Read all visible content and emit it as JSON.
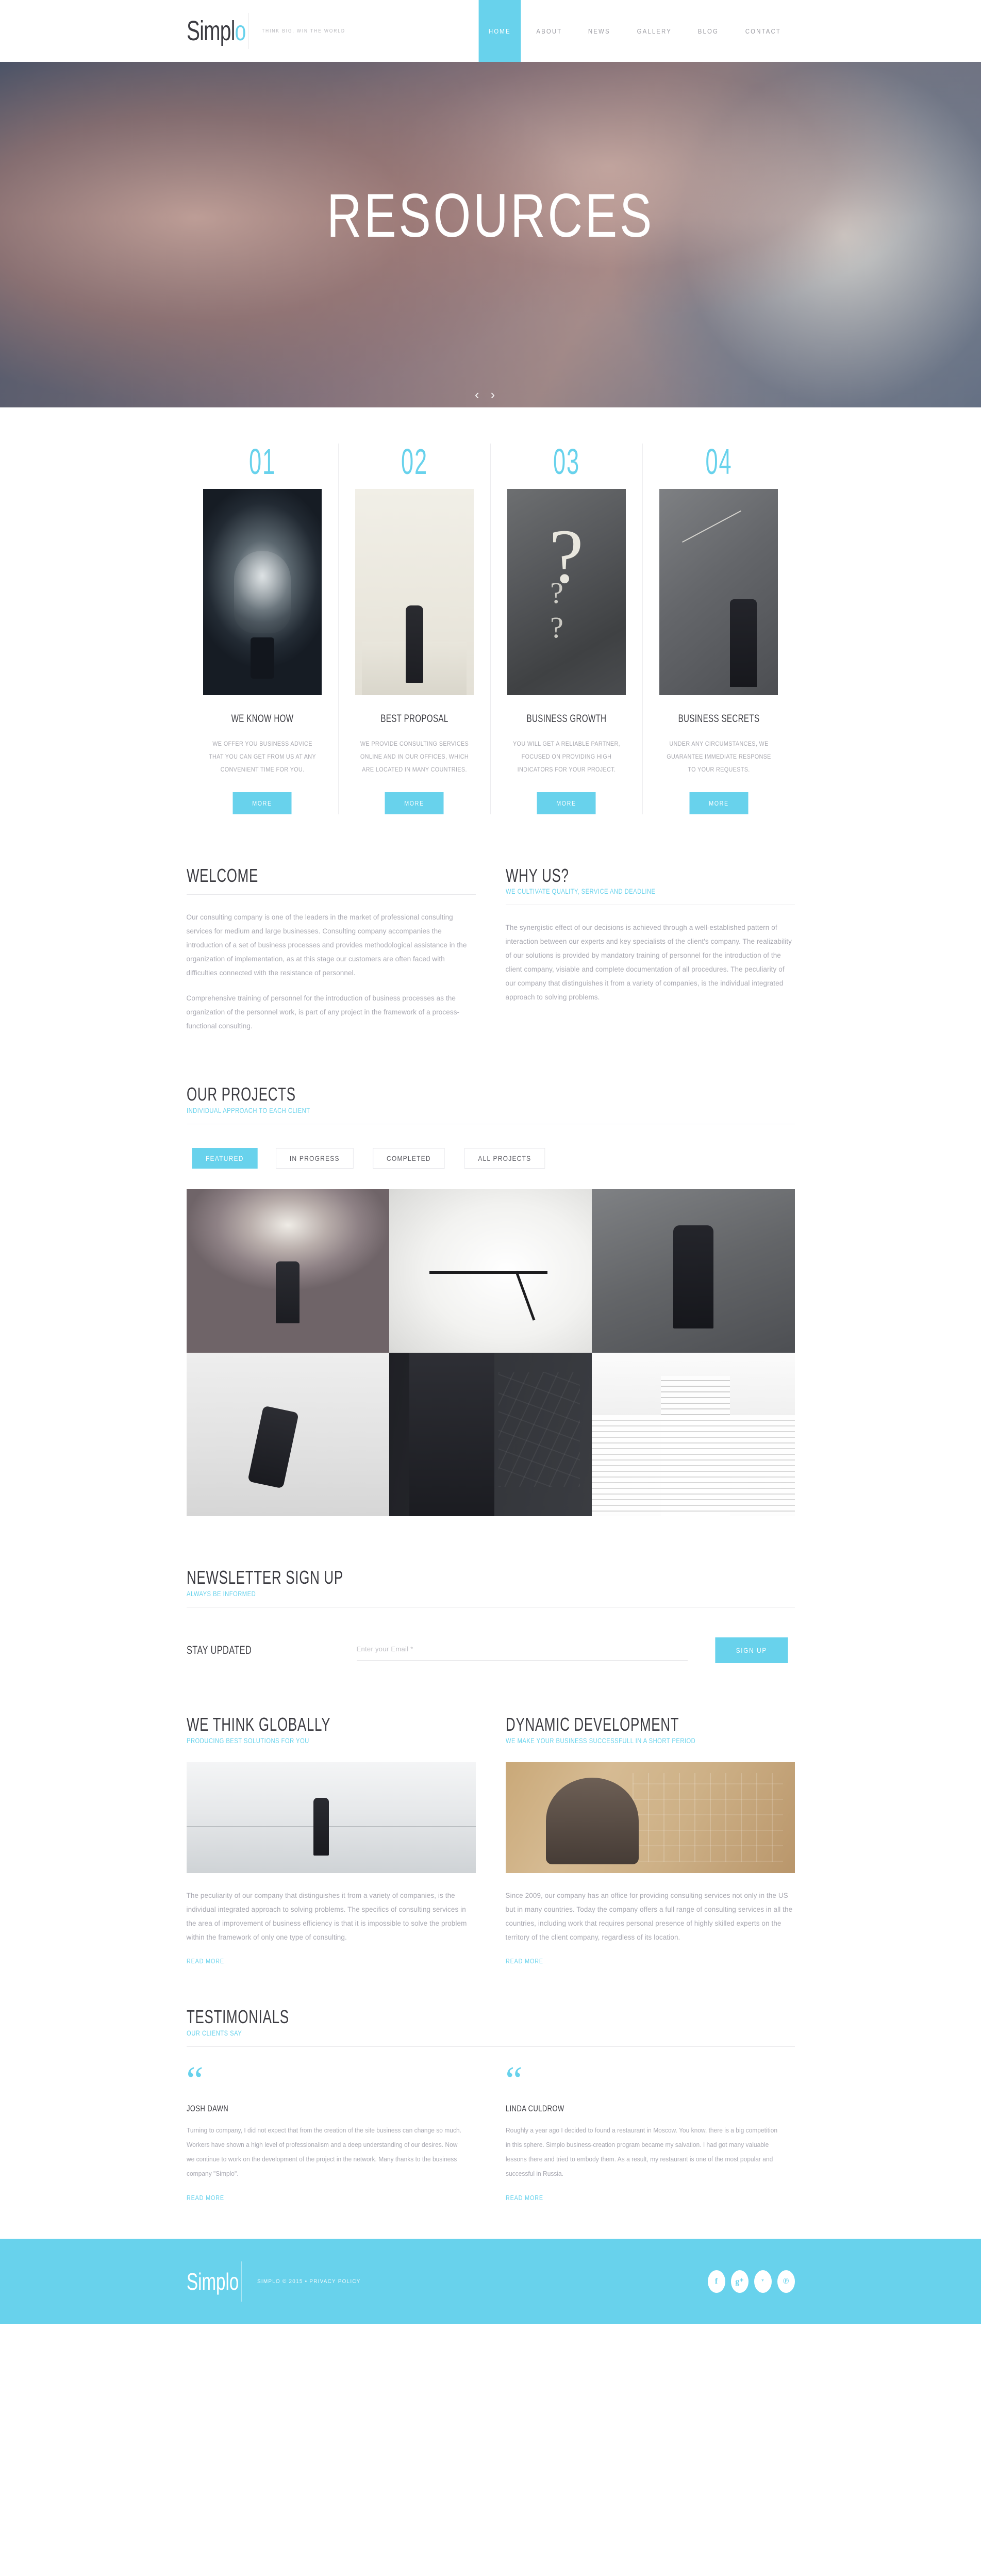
{
  "header": {
    "logo_main": "Simpl",
    "logo_accent": "o",
    "tagline": "Think big, win the world",
    "nav": [
      {
        "label": "Home",
        "active": true
      },
      {
        "label": "About",
        "active": false
      },
      {
        "label": "News",
        "active": false
      },
      {
        "label": "Gallery",
        "active": false
      },
      {
        "label": "Blog",
        "active": false
      },
      {
        "label": "Contact",
        "active": false
      }
    ]
  },
  "hero": {
    "title": "Resources",
    "prev_arrow": "‹",
    "next_arrow": "›"
  },
  "services": [
    {
      "number": "01",
      "title": "We Know How",
      "text": "We offer you business advice that you can get from us at any convenient time for you.",
      "button": "More",
      "image": "lightbulb-idea-photo"
    },
    {
      "number": "02",
      "title": "Best Proposal",
      "text": "We provide consulting services online and in our offices, which are located in many countries.",
      "button": "More",
      "image": "businessman-on-podium-photo"
    },
    {
      "number": "03",
      "title": "Business Growth",
      "text": "You will get a reliable partner, focused on providing high indicators for your project.",
      "button": "More",
      "image": "question-marks-photo"
    },
    {
      "number": "04",
      "title": "Business Secrets",
      "text": "Under any circumstances, we guarantee immediate response to your requests.",
      "button": "More",
      "image": "man-drawing-chart-photo"
    }
  ],
  "welcome": {
    "title": "Welcome",
    "para1": "Our consulting company is one of the leaders in the market of professional consulting services for medium and large businesses. Consulting company accompanies the introduction of a set of business processes and provides methodological assistance in the organization of implementation, as at this stage our customers are often faced with difficulties connected with the resistance of personnel.",
    "para2": "Comprehensive training of personnel for the introduction of business processes as the organization of the personnel work, is part of any project in the framework of a process-functional consulting."
  },
  "why_us": {
    "title": "Why Us?",
    "subtitle": "We cultivate quality, service and deadline",
    "para1": "The synergistic effect of our decisions is achieved through a well-established pattern of interaction between our experts and key specialists of the client's company. The realizability of our solutions is provided by mandatory training of personnel for the introduction of the client company, visiable and complete documentation of all procedures. The peculiarity of our company that distinguishes it from a variety of companies, is the individual integrated approach to solving problems."
  },
  "projects": {
    "title": "Our Projects",
    "subtitle": "Individual approach to each client",
    "filters": [
      {
        "label": "Featured",
        "active": true
      },
      {
        "label": "In Progress",
        "active": false
      },
      {
        "label": "Completed",
        "active": false
      },
      {
        "label": "All Projects",
        "active": false
      }
    ],
    "items": [
      {
        "name": "man-with-lightbulb-balloons-photo"
      },
      {
        "name": "clock-face-photo"
      },
      {
        "name": "businessman-flexing-photo"
      },
      {
        "name": "running-businessman-photo"
      },
      {
        "name": "suit-with-chalkboard-photo"
      },
      {
        "name": "stacked-books-photo"
      }
    ]
  },
  "newsletter": {
    "title": "Newsletter Sign Up",
    "subtitle": "Always be informed",
    "stay_updated": "Stay Updated",
    "email_placeholder": "Enter your Email *",
    "email_value": "",
    "button": "Sign Up"
  },
  "features": [
    {
      "title": "We Think Globally",
      "subtitle": "Producing best solutions for you",
      "text": "The peculiarity of our company that distinguishes it from a variety of companies, is the individual integrated approach to solving problems. The specifics of consulting services in the area of improvement of business efficiency is that it is impossible to solve the problem within the framework of only one type of consulting.",
      "link": "Read More",
      "image": "businessman-in-corridor-photo"
    },
    {
      "title": "Dynamic Development",
      "subtitle": "We make your business successfull in a short period",
      "text": "Since 2009, our company has an office for providing consulting services not only in the US but in many countries. Today the company offers a full range of consulting services in all the countries, including work that requires personal presence of highly skilled experts on the territory of the client company, regardless of its location.",
      "link": "Read More",
      "image": "thinking-man-with-charts-photo"
    }
  ],
  "testimonials": {
    "title": "Testimonials",
    "subtitle": "Our clients say",
    "quote_glyph": "“",
    "items": [
      {
        "name": "Josh Dawn",
        "text": "Turning to company, I did not expect that from the creation of the site business can change so much. Workers have shown a high level of professionalism and a deep understanding of our desires. Now we continue to work on the development of the project in the network. Many thanks to the business company \"Simplo\".",
        "link": "Read More"
      },
      {
        "name": "Linda Culdrow",
        "text": "Roughly a year ago I decided to found a restaurant in Moscow. You know, there is a big competition in this sphere. Simplo business-creation program became my salvation. I had got many valuable lessons there and tried to embody them. As a result, my restaurant is one of the most popular and successful in Russia.",
        "link": "Read More"
      }
    ]
  },
  "footer": {
    "logo": "Simplo",
    "copyright": "Simplo © 2015 • Privacy Policy",
    "socials": [
      {
        "name": "facebook",
        "glyph": "f"
      },
      {
        "name": "google-plus",
        "glyph": "g⁺"
      },
      {
        "name": "twitter",
        "glyph": "ᵛ"
      },
      {
        "name": "pinterest",
        "glyph": "℗"
      }
    ]
  },
  "colors": {
    "accent": "#68d2ec",
    "heading": "#3c3c42",
    "body": "#a9a9b2"
  }
}
